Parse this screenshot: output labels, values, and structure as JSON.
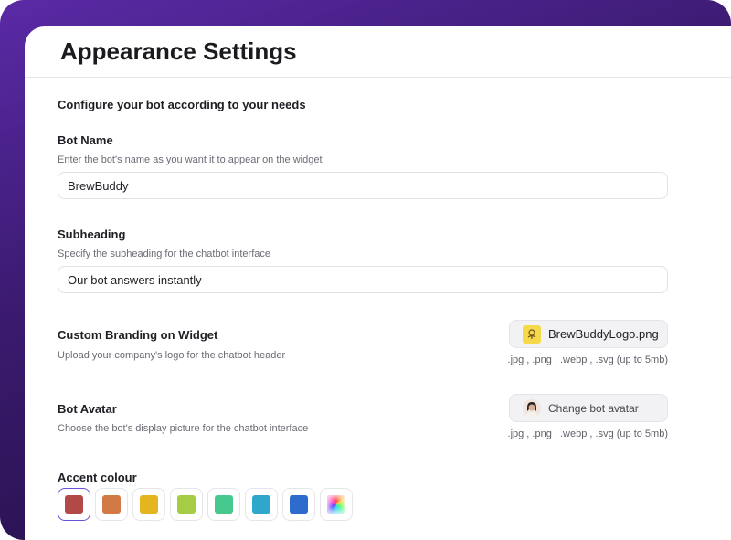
{
  "page_title": "Appearance Settings",
  "intro": "Configure your bot according to your needs",
  "bot_name": {
    "label": "Bot Name",
    "description": "Enter the bot's name as you want it to appear on the widget",
    "value": "BrewBuddy"
  },
  "subheading": {
    "label": "Subheading",
    "description": "Specify the subheading for the chatbot interface",
    "value": "Our bot answers instantly"
  },
  "branding": {
    "label": "Custom Branding on Widget",
    "description": "Upload your company's logo for the chatbot header",
    "file_name": "BrewBuddyLogo.png",
    "hint": ".jpg , .png , .webp , .svg (up to 5mb)",
    "icon": "brand-logo-icon"
  },
  "avatar": {
    "label": "Bot Avatar",
    "description": "Choose the bot's display picture for the chatbot interface",
    "button_label": "Change bot avatar",
    "hint": ".jpg , .png , .webp , .svg (up to 5mb)",
    "icon": "avatar-icon"
  },
  "accent": {
    "label": "Accent colour",
    "selected_index": 0,
    "swatches": [
      "#b24848",
      "#d27a45",
      "#e3b620",
      "#a5cc45",
      "#45c98e",
      "#2fa6cb",
      "#2d6ccc",
      "custom-gradient"
    ]
  }
}
